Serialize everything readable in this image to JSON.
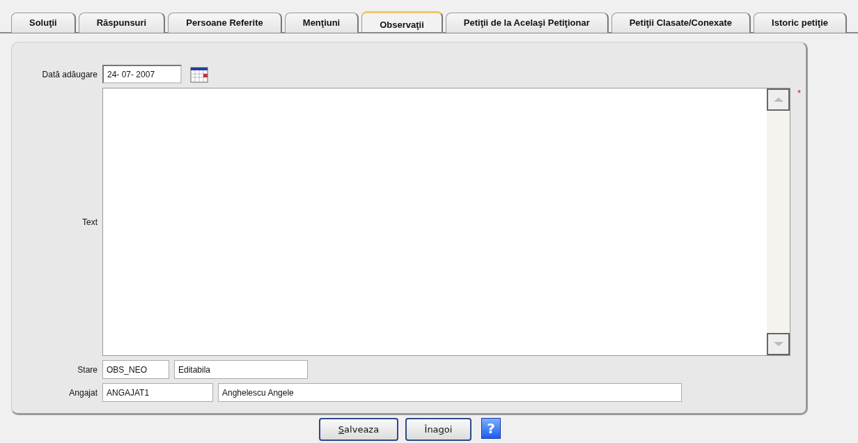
{
  "tabs": [
    {
      "label": "Soluţii",
      "selected": false
    },
    {
      "label": "Răspunsuri",
      "selected": false
    },
    {
      "label": "Persoane Referite",
      "selected": false
    },
    {
      "label": "Menţiuni",
      "selected": false
    },
    {
      "label": "Observaţii",
      "selected": true
    },
    {
      "label": "Petiţii de la Acelaşi Petiţionar",
      "selected": false
    },
    {
      "label": "Petiţii Clasate/Conexate",
      "selected": false
    },
    {
      "label": "Istoric petiţie",
      "selected": false
    }
  ],
  "form": {
    "date_label": "Dată adăugare",
    "date_value": "24- 07- 2007",
    "text_label": "Text",
    "required_mark": "*",
    "stare_label": "Stare",
    "stare_code": "OBS_NEO",
    "stare_name": "Editabila",
    "angajat_label": "Angajat",
    "angajat_code": "ANGAJAT1",
    "angajat_name": "Anghelescu Angele"
  },
  "buttons": [
    {
      "kind": "text",
      "hotkey": "S",
      "after": "alveaza"
    },
    {
      "kind": "text",
      "before": "Îna",
      "hotkey": "g",
      "after": "oi"
    },
    {
      "kind": "help",
      "label": "?"
    }
  ]
}
